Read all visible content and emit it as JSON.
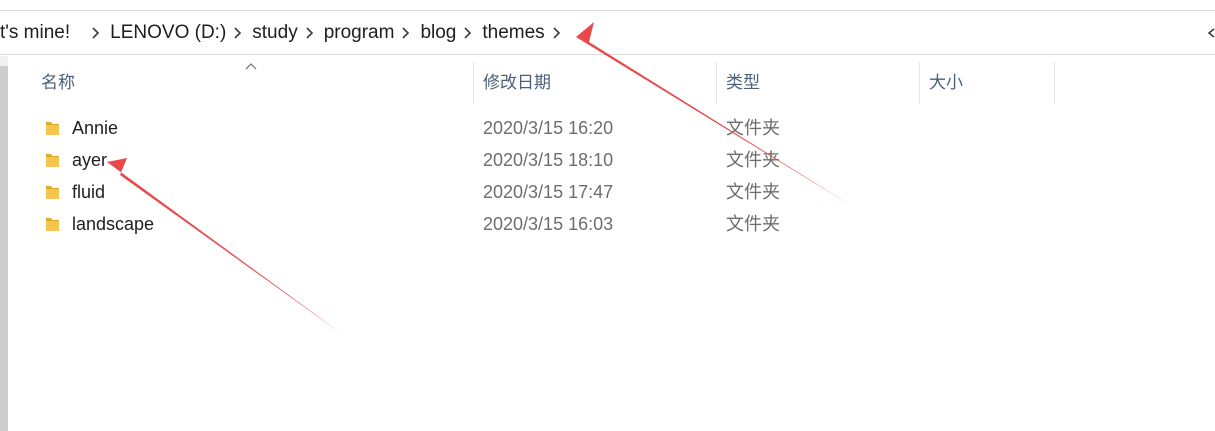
{
  "breadcrumb": {
    "segments": [
      {
        "label": "t's mine!"
      },
      {
        "label": "LENOVO (D:)"
      },
      {
        "label": "study"
      },
      {
        "label": "program"
      },
      {
        "label": "blog"
      },
      {
        "label": "themes"
      }
    ]
  },
  "columns": {
    "name": "名称",
    "modified": "修改日期",
    "type": "类型",
    "size": "大小"
  },
  "files": [
    {
      "name": "Annie",
      "modified": "2020/3/15 16:20",
      "type": "文件夹",
      "icon": "folder-icon"
    },
    {
      "name": "ayer",
      "modified": "2020/3/15 18:10",
      "type": "文件夹",
      "icon": "folder-icon"
    },
    {
      "name": "fluid",
      "modified": "2020/3/15 17:47",
      "type": "文件夹",
      "icon": "folder-icon"
    },
    {
      "name": "landscape",
      "modified": "2020/3/15 16:03",
      "type": "文件夹",
      "icon": "folder-icon"
    }
  ],
  "colors": {
    "annotation_arrow": "#e8393d",
    "header_text": "#4c607a",
    "folder_yellow": "#f4c64e"
  }
}
